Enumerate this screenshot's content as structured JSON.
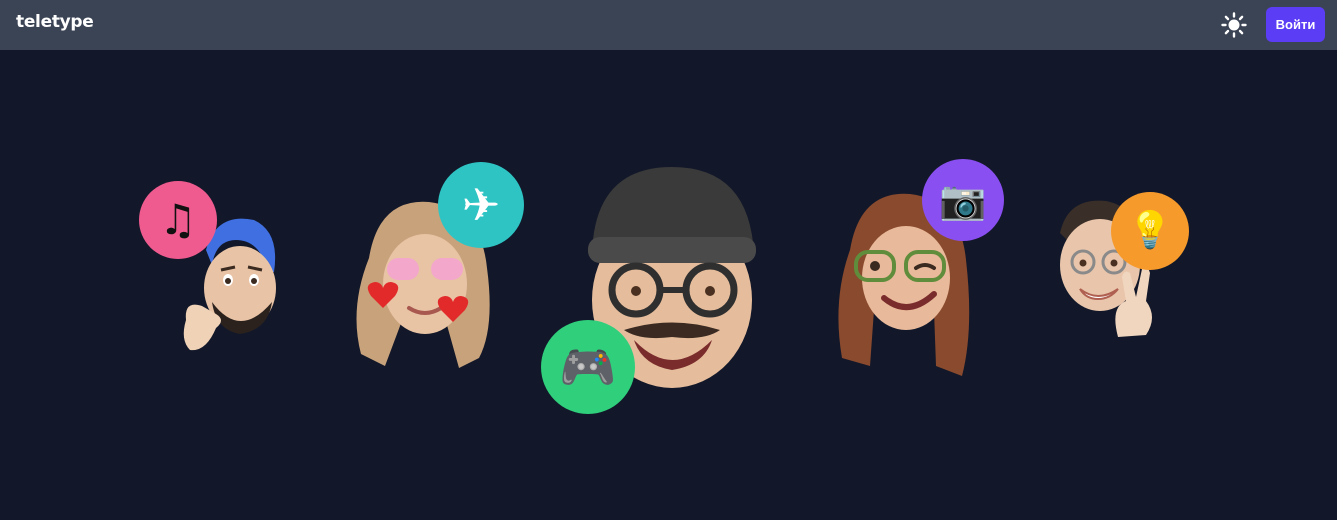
{
  "header": {
    "logo_text": "teletype",
    "login_label": "Войти",
    "theme_icon": "sun-icon",
    "background": "#3b4455",
    "accent": "#5b3df5"
  },
  "hero": {
    "background": "#121829",
    "avatars": [
      {
        "name": "thinking-man",
        "badge_icon": "music-note-icon",
        "badge_glyph": "♫",
        "badge_color": "#ef5b8f"
      },
      {
        "name": "woman-pink-glasses",
        "badge_icon": "airplane-icon",
        "badge_glyph": "✈",
        "badge_color": "#2ec4c4"
      },
      {
        "name": "man-beanie",
        "badge_icon": "gamepad-icon",
        "badge_glyph": "🎮",
        "badge_color": "#2fcf7c"
      },
      {
        "name": "woman-winking",
        "badge_icon": "camera-icon",
        "badge_glyph": "📷",
        "badge_color": "#8a4ff0"
      },
      {
        "name": "man-peace-sign",
        "badge_icon": "lightbulb-icon",
        "badge_glyph": "💡",
        "badge_color": "#f79a2c"
      }
    ]
  }
}
